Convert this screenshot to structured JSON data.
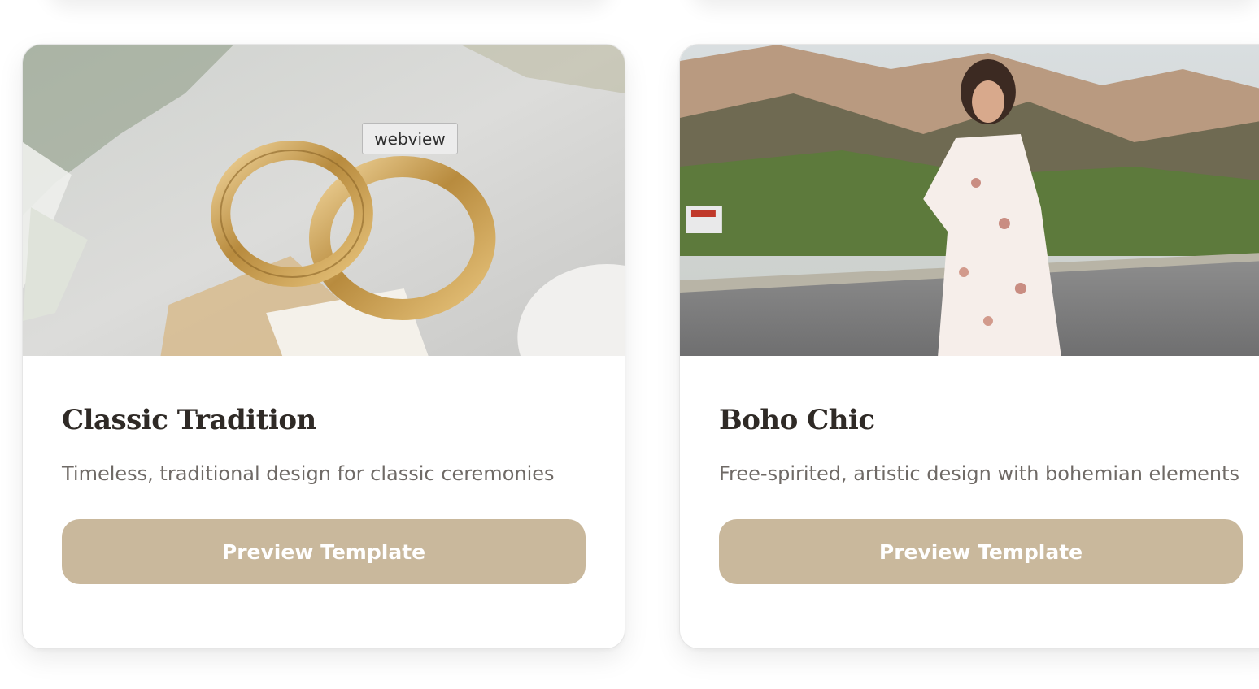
{
  "overlay_tag": "webview",
  "accent_color": "#c9b89c",
  "templates": [
    {
      "title": "Classic Tradition",
      "description": "Timeless, traditional design for classic ceremonies",
      "button_label": "Preview Template",
      "image_subject": "gold-wedding-rings-photo"
    },
    {
      "title": "Boho Chic",
      "description": "Free-spirited, artistic design with bohemian elements",
      "button_label": "Preview Template",
      "image_subject": "woman-in-floral-dress-on-road-photo"
    }
  ]
}
